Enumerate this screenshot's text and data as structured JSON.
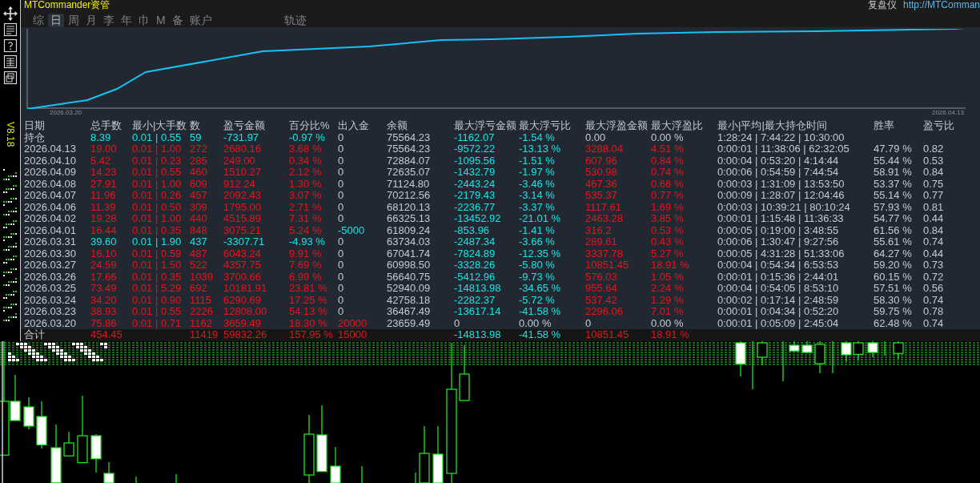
{
  "app": {
    "title": "MTCommander资管",
    "replay_label": "复盘仪",
    "link": "http://MTComman"
  },
  "tabs": [
    {
      "label": "综",
      "selected": false
    },
    {
      "label": "日",
      "selected": true
    },
    {
      "label": "周",
      "selected": false
    },
    {
      "label": "月",
      "selected": false
    },
    {
      "label": "李",
      "selected": false
    },
    {
      "label": "年",
      "selected": false
    },
    {
      "label": "巾",
      "selected": false
    },
    {
      "label": "M",
      "selected": false
    },
    {
      "label": "备",
      "selected": false
    },
    {
      "label": "账户",
      "selected": false
    },
    {
      "label": "轨迹",
      "selected": false
    }
  ],
  "equity_chart": {
    "start_date": "2026.03.20",
    "end_date": "2026.04.13"
  },
  "version": "V8.18",
  "table": {
    "columns": [
      "日期",
      "总手数",
      "最小|大手数",
      "数",
      "盈亏金额",
      "百分比%",
      "出入金",
      "余额",
      "最大浮亏金额",
      "最大浮亏比",
      "最大浮盈金额",
      "最大浮盈比",
      "最小|平均|最大持仓时间",
      "胜率",
      "盈亏比"
    ],
    "rows": [
      {
        "date": "持仓",
        "lots": "8.39",
        "min_max": "0.01 | 0.55",
        "trades": "59",
        "pnl": "-731.97",
        "pct": "-0.97 %",
        "kind": "down",
        "flow": {
          "amount": "0",
          "kind": "flat"
        },
        "balance": "75564.23",
        "float_loss": {
          "amount": "-1162.07",
          "ratio": "-1.54 %",
          "kind": "down"
        },
        "float_gain": {
          "amount": "0.00",
          "ratio": "0.00 %",
          "kind": "flat"
        },
        "hold": "1:28:24 | 7:44:22 | 10:30:00"
      },
      {
        "date": "2026.04.13",
        "lots": "19.00",
        "min_max": "0.01 | 1.00",
        "trades": "272",
        "pnl": "2680.16",
        "pct": "3.68 %",
        "kind": "up",
        "flow": {
          "amount": "0",
          "kind": "flat"
        },
        "balance": "75564.23",
        "float_loss": {
          "amount": "-9572.22",
          "ratio": "-13.13 %",
          "kind": "down"
        },
        "float_gain": {
          "amount": "3288.04",
          "ratio": "4.51 %",
          "kind": "up"
        },
        "hold": "0:00:01 | 11:38:06 | 62:32:05",
        "win_rate": "47.79 %",
        "pl_ratio": "0.82"
      },
      {
        "date": "2026.04.10",
        "lots": "5.42",
        "min_max": "0.01 | 0.23",
        "trades": "285",
        "pnl": "249.00",
        "pct": "0.34 %",
        "kind": "up",
        "flow": {
          "amount": "0",
          "kind": "flat"
        },
        "balance": "72884.07",
        "float_loss": {
          "amount": "-1095.56",
          "ratio": "-1.51 %",
          "kind": "down"
        },
        "float_gain": {
          "amount": "607.96",
          "ratio": "0.84 %",
          "kind": "up"
        },
        "hold": "0:00:04 | 0:53:20 | 4:14:44",
        "win_rate": "55.44 %",
        "pl_ratio": "0.53"
      },
      {
        "date": "2026.04.09",
        "lots": "14.23",
        "min_max": "0.01 | 0.55",
        "trades": "460",
        "pnl": "1510.27",
        "pct": "2.12 %",
        "kind": "up",
        "flow": {
          "amount": "0",
          "kind": "flat"
        },
        "balance": "72635.07",
        "float_loss": {
          "amount": "-1432.79",
          "ratio": "-1.97 %",
          "kind": "down"
        },
        "float_gain": {
          "amount": "530.98",
          "ratio": "0.74 %",
          "kind": "up"
        },
        "hold": "0:00:06 | 0:54:59 | 7:44:54",
        "win_rate": "58.91 %",
        "pl_ratio": "0.84"
      },
      {
        "date": "2026.04.08",
        "lots": "27.91",
        "min_max": "0.01 | 1.00",
        "trades": "609",
        "pnl": "912.24",
        "pct": "1.30 %",
        "kind": "up",
        "flow": {
          "amount": "0",
          "kind": "flat"
        },
        "balance": "71124.80",
        "float_loss": {
          "amount": "-2443.24",
          "ratio": "-3.46 %",
          "kind": "down"
        },
        "float_gain": {
          "amount": "467.36",
          "ratio": "0.66 %",
          "kind": "up"
        },
        "hold": "0:00:03 | 1:31:09 | 13:53:50",
        "win_rate": "53.37 %",
        "pl_ratio": "0.75"
      },
      {
        "date": "2026.04.07",
        "lots": "11.96",
        "min_max": "0.01 | 0.26",
        "trades": "457",
        "pnl": "2092.43",
        "pct": "3.07 %",
        "kind": "up",
        "flow": {
          "amount": "0",
          "kind": "flat"
        },
        "balance": "70212.56",
        "float_loss": {
          "amount": "-2179.43",
          "ratio": "-3.14 %",
          "kind": "down"
        },
        "float_gain": {
          "amount": "535.37",
          "ratio": "0.77 %",
          "kind": "up"
        },
        "hold": "0:00:09 | 1:28:07 | 12:04:46",
        "win_rate": "55.14 %",
        "pl_ratio": "0.77"
      },
      {
        "date": "2026.04.06",
        "lots": "11.39",
        "min_max": "0.01 | 0.50",
        "trades": "309",
        "pnl": "1795.00",
        "pct": "2.71 %",
        "kind": "up",
        "flow": {
          "amount": "0",
          "kind": "flat"
        },
        "balance": "68120.13",
        "float_loss": {
          "amount": "-2236.77",
          "ratio": "-3.37 %",
          "kind": "down"
        },
        "float_gain": {
          "amount": "1117.61",
          "ratio": "1.69 %",
          "kind": "up"
        },
        "hold": "0:00:03 | 10:39:21 | 80:10:24",
        "win_rate": "57.93 %",
        "pl_ratio": "0.81"
      },
      {
        "date": "2026.04.02",
        "lots": "19.28",
        "min_max": "0.01 | 1.00",
        "trades": "440",
        "pnl": "4515.89",
        "pct": "7.31 %",
        "kind": "up",
        "flow": {
          "amount": "0",
          "kind": "flat"
        },
        "balance": "66325.13",
        "float_loss": {
          "amount": "-13452.92",
          "ratio": "-21.01 %",
          "kind": "down"
        },
        "float_gain": {
          "amount": "2463.28",
          "ratio": "3.85 %",
          "kind": "up"
        },
        "hold": "0:00:01 | 1:15:48 | 11:36:33",
        "win_rate": "54.77 %",
        "pl_ratio": "0.44"
      },
      {
        "date": "2026.04.01",
        "lots": "16.44",
        "min_max": "0.01 | 0.35",
        "trades": "848",
        "pnl": "3075.21",
        "pct": "5.24 %",
        "kind": "up",
        "flow": {
          "amount": "-5000",
          "kind": "down"
        },
        "balance": "61809.24",
        "float_loss": {
          "amount": "-853.96",
          "ratio": "-1.41 %",
          "kind": "down"
        },
        "float_gain": {
          "amount": "316.2",
          "ratio": "0.53 %",
          "kind": "up"
        },
        "hold": "0:00:05 | 0:19:00 | 3:48:55",
        "win_rate": "61.56 %",
        "pl_ratio": "0.84"
      },
      {
        "date": "2026.03.31",
        "lots": "39.60",
        "min_max": "0.01 | 1.90",
        "trades": "437",
        "pnl": "-3307.71",
        "pct": "-4.93 %",
        "kind": "down",
        "flow": {
          "amount": "0",
          "kind": "flat"
        },
        "balance": "63734.03",
        "float_loss": {
          "amount": "-2487.34",
          "ratio": "-3.66 %",
          "kind": "down"
        },
        "float_gain": {
          "amount": "289.61",
          "ratio": "0.43 %",
          "kind": "up"
        },
        "hold": "0:00:06 | 1:30:47 | 9:27:56",
        "win_rate": "55.61 %",
        "pl_ratio": "0.74"
      },
      {
        "date": "2026.03.30",
        "lots": "16.10",
        "min_max": "0.01 | 0.59",
        "trades": "487",
        "pnl": "6043.24",
        "pct": "9.91 %",
        "kind": "up",
        "flow": {
          "amount": "0",
          "kind": "flat"
        },
        "balance": "67041.74",
        "float_loss": {
          "amount": "-7824.89",
          "ratio": "-12.35 %",
          "kind": "down"
        },
        "float_gain": {
          "amount": "3337.78",
          "ratio": "5.27 %",
          "kind": "up"
        },
        "hold": "0:00:05 | 4:31:28 | 51:33:06",
        "win_rate": "64.27 %",
        "pl_ratio": "0.44"
      },
      {
        "date": "2026.03.27",
        "lots": "24.59",
        "min_max": "0.01 | 1.50",
        "trades": "522",
        "pnl": "4357.75",
        "pct": "7.69 %",
        "kind": "up",
        "flow": {
          "amount": "0",
          "kind": "flat"
        },
        "balance": "60998.50",
        "float_loss": {
          "amount": "-3328.26",
          "ratio": "-5.80 %",
          "kind": "down"
        },
        "float_gain": {
          "amount": "10851.45",
          "ratio": "18.91 %",
          "kind": "up"
        },
        "hold": "0:00:04 | 0:54:34 | 6:53:53",
        "win_rate": "59.20 %",
        "pl_ratio": "0.73"
      },
      {
        "date": "2026.03.26",
        "lots": "17.66",
        "min_max": "0.01 | 0.35",
        "trades": "1039",
        "pnl": "3700.66",
        "pct": "6.99 %",
        "kind": "up",
        "flow": {
          "amount": "0",
          "kind": "flat"
        },
        "balance": "56640.75",
        "float_loss": {
          "amount": "-5412.96",
          "ratio": "-9.73 %",
          "kind": "down"
        },
        "float_gain": {
          "amount": "576.03",
          "ratio": "1.05 %",
          "kind": "up"
        },
        "hold": "0:00:01 | 0:15:36 | 2:44:01",
        "win_rate": "60.15 %",
        "pl_ratio": "0.72"
      },
      {
        "date": "2026.03.25",
        "lots": "73.49",
        "min_max": "0.01 | 5.29",
        "trades": "692",
        "pnl": "10181.91",
        "pct": "23.81 %",
        "kind": "up",
        "flow": {
          "amount": "0",
          "kind": "flat"
        },
        "balance": "52940.09",
        "float_loss": {
          "amount": "-14813.98",
          "ratio": "-34.65 %",
          "kind": "down"
        },
        "float_gain": {
          "amount": "955.64",
          "ratio": "2.24 %",
          "kind": "up"
        },
        "hold": "0:00:04 | 0:54:05 | 8:53:10",
        "win_rate": "57.51 %",
        "pl_ratio": "0.56"
      },
      {
        "date": "2026.03.24",
        "lots": "34.20",
        "min_max": "0.01 | 0.90",
        "trades": "1115",
        "pnl": "6290.69",
        "pct": "17.25 %",
        "kind": "up",
        "flow": {
          "amount": "0",
          "kind": "flat"
        },
        "balance": "42758.18",
        "float_loss": {
          "amount": "-2282.37",
          "ratio": "-5.72 %",
          "kind": "down"
        },
        "float_gain": {
          "amount": "537.42",
          "ratio": "1.29 %",
          "kind": "up"
        },
        "hold": "0:00:02 | 0:17:14 | 2:48:59",
        "win_rate": "58.30 %",
        "pl_ratio": "0.74"
      },
      {
        "date": "2026.03.23",
        "lots": "38.93",
        "min_max": "0.01 | 0.55",
        "trades": "2226",
        "pnl": "12808.00",
        "pct": "54.13 %",
        "kind": "up",
        "flow": {
          "amount": "0",
          "kind": "flat"
        },
        "balance": "36467.49",
        "float_loss": {
          "amount": "-13617.14",
          "ratio": "-41.58 %",
          "kind": "down"
        },
        "float_gain": {
          "amount": "2296.06",
          "ratio": "7.01 %",
          "kind": "up"
        },
        "hold": "0:00:01 | 0:04:34 | 0:52:20",
        "win_rate": "59.75 %",
        "pl_ratio": "0.78"
      },
      {
        "date": "2026.03.20",
        "lots": "75.86",
        "min_max": "0.01 | 0.71",
        "trades": "1162",
        "pnl": "3659.49",
        "pct": "18.30 %",
        "kind": "up",
        "flow": {
          "amount": "20000",
          "kind": "up"
        },
        "balance": "23659.49",
        "float_loss": {
          "amount": "0",
          "ratio": "0.00 %",
          "kind": "flat"
        },
        "float_gain": {
          "amount": "0",
          "ratio": "0.00 %",
          "kind": "flat"
        },
        "hold": "0:00:01 | 0:05:09 | 2:45:04",
        "win_rate": "62.48 %",
        "pl_ratio": "0.74"
      },
      {
        "date": "合计",
        "lots": "454.45",
        "trades": "11419",
        "pnl": "59832.26",
        "pct": "157.95 %",
        "kind": "total",
        "flow": {
          "amount": "15000",
          "kind": "up"
        },
        "float_loss": {
          "amount": "-14813.98",
          "ratio": "-41.58 %",
          "kind": "down"
        },
        "float_gain": {
          "amount": "10851.45",
          "ratio": "18.91 %",
          "kind": "up"
        }
      }
    ]
  }
}
